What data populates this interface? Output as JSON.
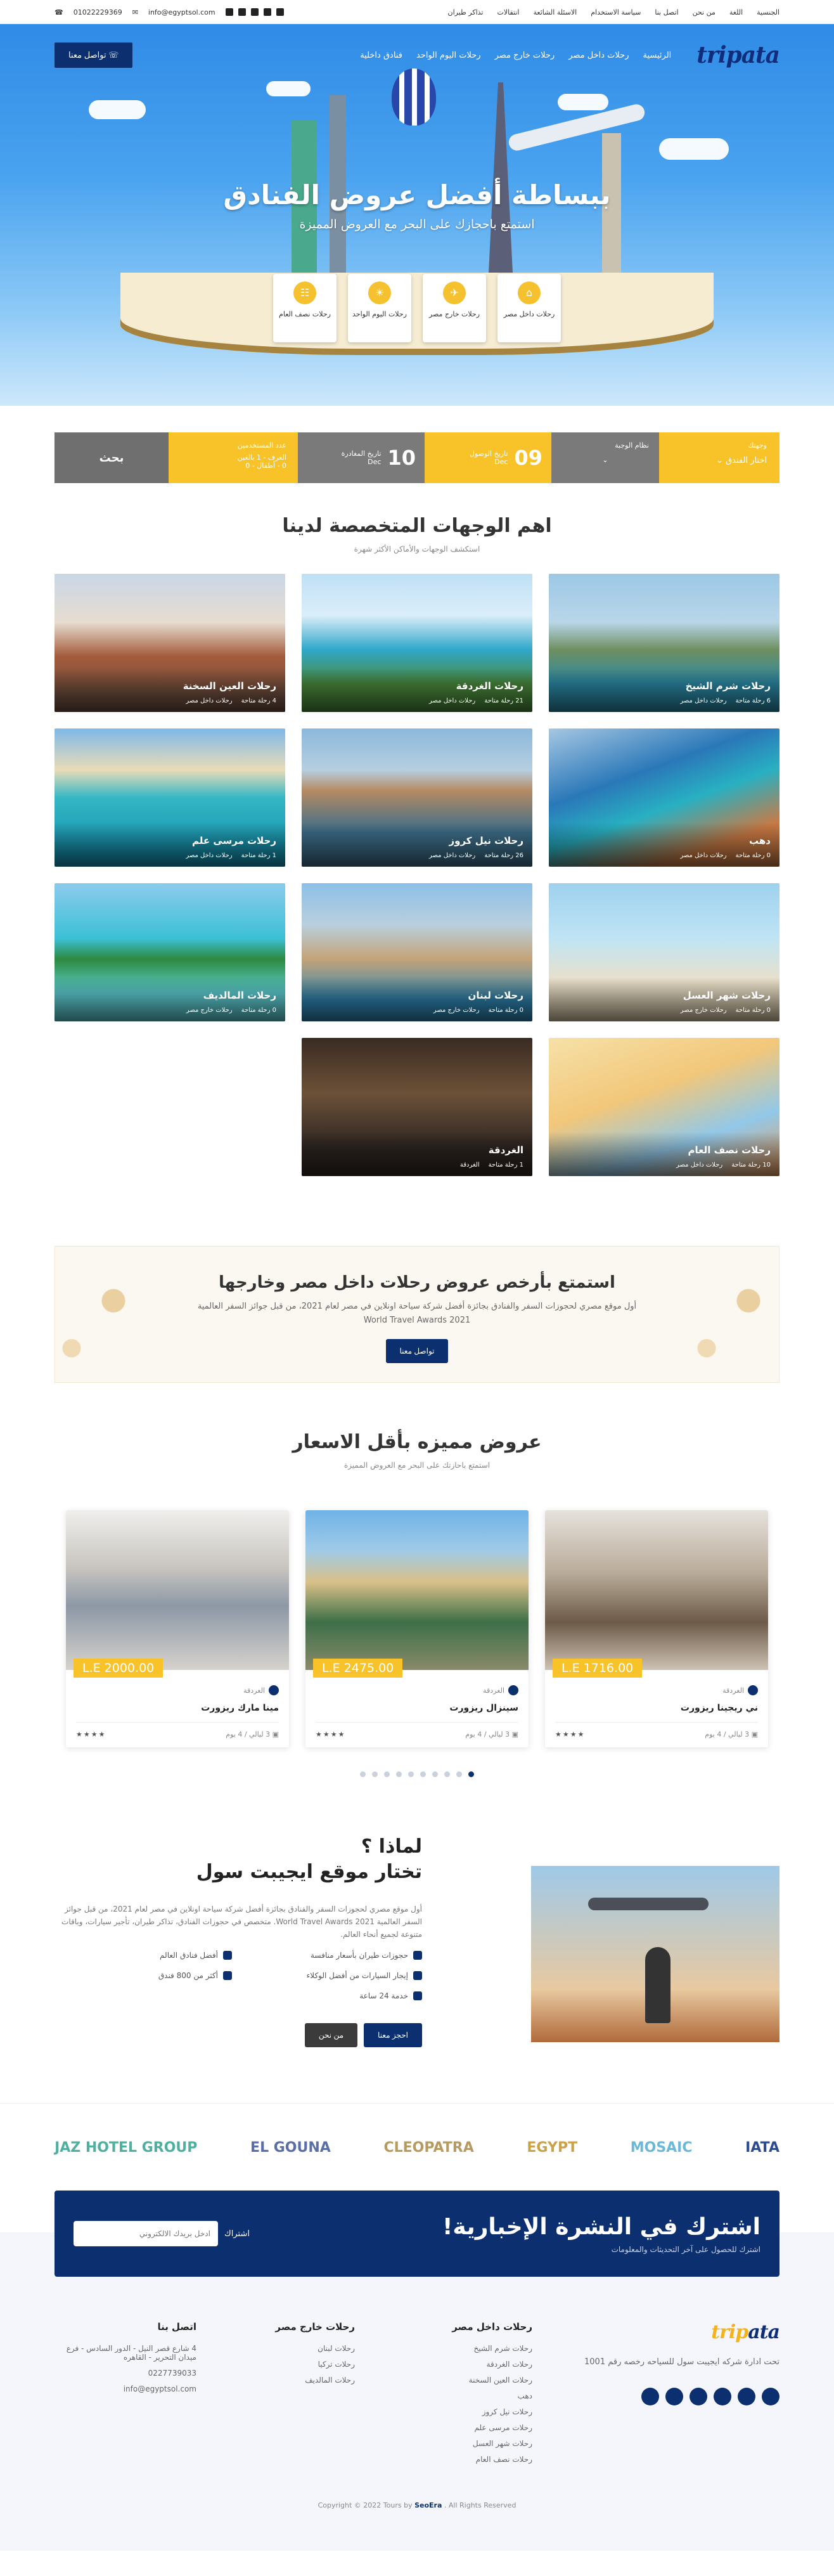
{
  "topbar": {
    "links": [
      "الجنسية",
      "اللغة",
      "من نحن",
      "اتصل بنا",
      "سياسة الاستخدام",
      "الاسئلة الشائعة",
      "انتقالات",
      "تذاكر طيران"
    ],
    "email": "info@egyptsol.com",
    "phone": "01022229369"
  },
  "nav": {
    "logo_main": "trip",
    "logo_accent": "ata",
    "items": [
      "الرئيسية",
      "رحلات داخل مصر",
      "رحلات خارج مصر",
      "رحلات اليوم الواحد",
      "فنادق داخلية"
    ],
    "contact": "تواصل معنا"
  },
  "hero": {
    "title": "ببساطة أفضل عروض الفنادق",
    "subtitle": "استمتع باحجازك على البحر مع العروض المميزة",
    "categories": [
      "رحلات داخل مصر",
      "رحلات خارج مصر",
      "رحلات اليوم الواحد",
      "رحلات نصف العام"
    ]
  },
  "search": {
    "dest_label": "وجهتك",
    "dest_value": "اختار الفندق",
    "type_label": "نظام الوجبة",
    "checkin_label": "تاريخ الوصول",
    "checkin_day": "09",
    "checkin_month": "Dec",
    "checkout_label": "تاريخ المغادرة",
    "checkout_day": "10",
    "checkout_month": "Dec",
    "guests_label": "عدد المستخدمين",
    "guests_line1": "الغرف - 1 بالغين",
    "guests_line2": "0 - أطفال - 0",
    "submit": "بحث"
  },
  "destinations": {
    "title": "اهم الوجهات المتخصصة لدينا",
    "subtitle": "استكشف الوجهات والأماكن الأكثر شهرة",
    "items": [
      {
        "name": "رحلات شرم الشيخ",
        "count": "6 رحلة متاحة",
        "cat": "رحلات داخل مصر",
        "bg": "linear-gradient(180deg,#9cc8e6 0%,#b9d6e8 35%,#6e8f5f 55%,#2b8aa7 80%)"
      },
      {
        "name": "رحلات الغردقة",
        "count": "21 رحلة متاحة",
        "cat": "رحلات داخل مصر",
        "bg": "linear-gradient(180deg,#bfe0f5 0%,#dbeefa 30%,#2fa7c9 55%,#4b8b3c 80%)"
      },
      {
        "name": "رحلات العين السخنة",
        "count": "4 رحلة متاحة",
        "cat": "رحلات داخل مصر",
        "bg": "linear-gradient(180deg,#c9d7e6 0%,#e7ddd0 35%,#a35a3b 60%,#6f5040 90%)"
      },
      {
        "name": "دهب",
        "count": "0 رحلة متاحة",
        "cat": "رحلات داخل مصر",
        "bg": "linear-gradient(160deg,#a6c7e3 0%,#2a78b8 35%,#28b0c2 55%,#c97a44 80%)"
      },
      {
        "name": "رحلات نيل كروز",
        "count": "26 رحلة متاحة",
        "cat": "رحلات داخل مصر",
        "bg": "linear-gradient(180deg,#8bb8dc 0%,#b6cfe0 30%,#b58a62 45%,#3d6e8a 75%)"
      },
      {
        "name": "رحلات مرسى علم",
        "count": "1 رحلة متاحة",
        "cat": "رحلات داخل مصر",
        "bg": "linear-gradient(180deg,#7fb8e8 0%,#e9dcb8 30%,#35b7c4 50%,#1593b0 90%)"
      },
      {
        "name": "رحلات شهر العسل",
        "count": "0 رحلة متاحة",
        "cat": "رحلات خارج مصر",
        "bg": "linear-gradient(180deg,#9fd1ee 0%,#bfe4f4 40%,#e9e0cc 70%,#d8c8a6 100%)"
      },
      {
        "name": "رحلات لبنان",
        "count": "0 رحلة متاحة",
        "cat": "رحلات خارج مصر",
        "bg": "linear-gradient(180deg,#8cc0e8 0%,#b9cfdd 30%,#c4a377 55%,#2f87b4 85%)"
      },
      {
        "name": "رحلات المالديف",
        "count": "0 رحلة متاحة",
        "cat": "رحلات خارج مصر",
        "bg": "linear-gradient(180deg,#8ccbec 0%,#3cc0d6 40%,#2d8a3e 55%,#5fd0d6 80%)"
      },
      {
        "name": "رحلات نصف العام",
        "count": "10 رحلة متاحة",
        "cat": "رحلات داخل مصر",
        "bg": "linear-gradient(160deg,#f6e1a8 0%,#f2c77a 40%,#92c8e8 70%,#e89a5a 100%)"
      },
      {
        "name": "الغردقة",
        "count": "1 رحلة متاحة",
        "cat": "الغردقة",
        "bg": "linear-gradient(180deg,#3a2b22 0%,#6c5138 40%,#2f2622 80%)"
      }
    ]
  },
  "promo": {
    "title": "استمتع بأرخص عروض رحلات داخل مصر وخارجها",
    "text": "أول موقع مصري لحجوزات السفر والفنادق بجائزة أفضل شركة سياحة اونلاين في مصر لعام 2021، من قبل جوائز السفر العالمية World Travel Awards 2021",
    "button": "تواصل معنا"
  },
  "offers": {
    "title": "عروض مميزه بأقل الاسعار",
    "subtitle": "استمتع باحازتك على البحر مع العروض المميزة",
    "items": [
      {
        "price": "L.E 1716.00",
        "loc": "الغردقة",
        "name": "ني ريجينا ريزورت",
        "nights": "3 ليالي / 4 يوم",
        "bg": "linear-gradient(180deg,#e6e2dc 0%,#b8aa98 40%,#6d5a48 70%,#cdc2b4 100%)"
      },
      {
        "price": "L.E 2475.00",
        "loc": "الغردقة",
        "name": "سينزال ريزورت",
        "nights": "3 ليالي / 4 يوم",
        "bg": "linear-gradient(180deg,#6fb2e6 0%,#9fcbe8 25%,#d9c089 45%,#3d6f48 70%,#8a8a6a 100%)"
      },
      {
        "price": "L.E 2000.00",
        "loc": "الغردقة",
        "name": "مينا مارك ريزورت",
        "nights": "3 ليالي / 4 يوم",
        "bg": "linear-gradient(180deg,#f0efed 0%,#c9c6c0 35%,#8d98a6 60%,#d6d2cc 100%)"
      }
    ],
    "stars": "★★★★",
    "dots": 10
  },
  "why": {
    "title_line1": "لماذا ؟",
    "title_line2": "تختار موقع ايجيبت سول",
    "text": "أول موقع مصري لحجوزات السفر والفنادق بجائزة أفضل شركة سياحة اونلاين في مصر لعام 2021، من قبل جوائز السفر العالمية World Travel Awards 2021. متخصص في حجوزات الفنادق، تذاكر طيران، تأجير سيارات، وباقات متنوعة لجميع أنحاء العالم.",
    "features": [
      "حجوزات طيران بأسعار منافسة",
      "أفضل فنادق العالم",
      "إيجار السيارات من أفضل الوكلاء",
      "أكثر من 800 فندق",
      "خدمة 24 ساعة"
    ],
    "btn_book": "احجز معنا",
    "btn_about": "من نحن"
  },
  "partners": [
    "IATA",
    "MOSAIC",
    "EGYPT",
    "CLEOPATRA",
    "EL GOUNA",
    "JAZ HOTEL GROUP"
  ],
  "newsletter": {
    "title": "اشترك في النشرة الإخبارية!",
    "subtitle": "اشترك للحصول على آخر التحديثات والمعلومات",
    "placeholder": "ادخل بريدك الالكتروني",
    "button": "اشتراك"
  },
  "footer": {
    "brand_text": "تحت ادارة شركه ايجيبت سول للسياحه رخصه رقم 1001",
    "col1_title": "رحلات داخل مصر",
    "col1": [
      "رحلات شرم الشيخ",
      "رحلات الغردقة",
      "رحلات العين السخنة",
      "دهب",
      "رحلات نيل كروز",
      "رحلات مرسى علم",
      "رحلات شهر العسل",
      "رحلات نصف العام"
    ],
    "col2_title": "رحلات خارج مصر",
    "col2": [
      "رحلات لبنان",
      "رحلات تركيا",
      "رحلات المالديف"
    ],
    "col3_title": "اتصل بنا",
    "col3": [
      "4 شارع قصر النيل - الدور السادس - فرع ميدان التحرير - القاهره",
      "0227739033",
      "info@egyptsol.com"
    ],
    "copyright_pre": "Copyright © 2022 Tours by",
    "copyright_brand": "SeoEra",
    "copyright_post": ". All Rights Reserved"
  },
  "colors": {
    "navy": "#0b2f6f",
    "yellow": "#f7c328",
    "grey": "#7a7a7a"
  }
}
